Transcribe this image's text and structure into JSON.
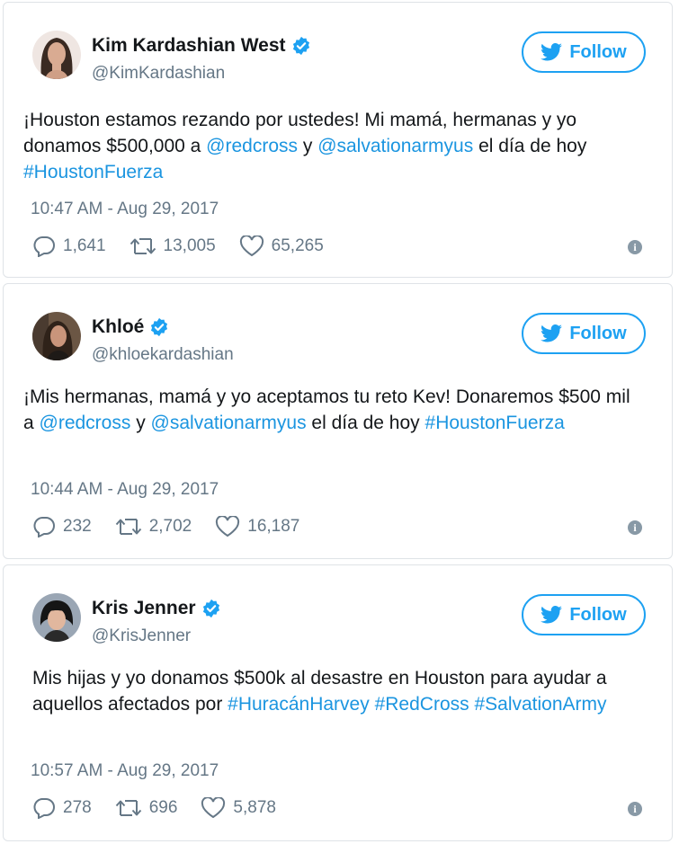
{
  "colors": {
    "link": "#1b95e0",
    "follow": "#1da1f2",
    "muted": "#657786",
    "verified": "#1da1f2"
  },
  "follow_label": "Follow",
  "tweets": [
    {
      "name": "Kim Kardashian West",
      "handle": "@KimKardashian",
      "text": [
        {
          "t": "¡Houston estamos rezando por ustedes! Mi mamá, hermanas y yo donamos $500,000 a ",
          "link": false
        },
        {
          "t": "@redcross",
          "link": true
        },
        {
          "t": " y ",
          "link": false
        },
        {
          "t": "@salvationarmyus",
          "link": true
        },
        {
          "t": " el día de hoy ",
          "link": false
        },
        {
          "t": "#HoustonFuerza",
          "link": true
        }
      ],
      "timestamp": "10:47 AM - Aug 29, 2017",
      "replies": "1,641",
      "retweets": "13,005",
      "likes": "65,265"
    },
    {
      "name": "Khloé",
      "handle": "@khloekardashian",
      "text": [
        {
          "t": "¡Mis hermanas, mamá y yo aceptamos tu reto Kev! Donaremos $500 mil a ",
          "link": false
        },
        {
          "t": "@redcross",
          "link": true
        },
        {
          "t": " y ",
          "link": false
        },
        {
          "t": "@salvationarmyus",
          "link": true
        },
        {
          "t": " el día de hoy ",
          "link": false
        },
        {
          "t": "#HoustonFuerza",
          "link": true
        }
      ],
      "timestamp": "10:44 AM - Aug 29, 2017",
      "replies": "232",
      "retweets": "2,702",
      "likes": "16,187"
    },
    {
      "name": "Kris Jenner",
      "handle": "@KrisJenner",
      "text": [
        {
          "t": "Mis hijas y yo donamos $500k al desastre en Houston para ayudar a aquellos afectados por ",
          "link": false
        },
        {
          "t": "#HuracánHarvey",
          "link": true
        },
        {
          "t": " ",
          "link": false
        },
        {
          "t": "#RedCross",
          "link": true
        },
        {
          "t": " ",
          "link": false
        },
        {
          "t": "#SalvationArmy",
          "link": true
        }
      ],
      "timestamp": "10:57 AM - Aug 29, 2017",
      "replies": "278",
      "retweets": "696",
      "likes": "5,878"
    }
  ]
}
